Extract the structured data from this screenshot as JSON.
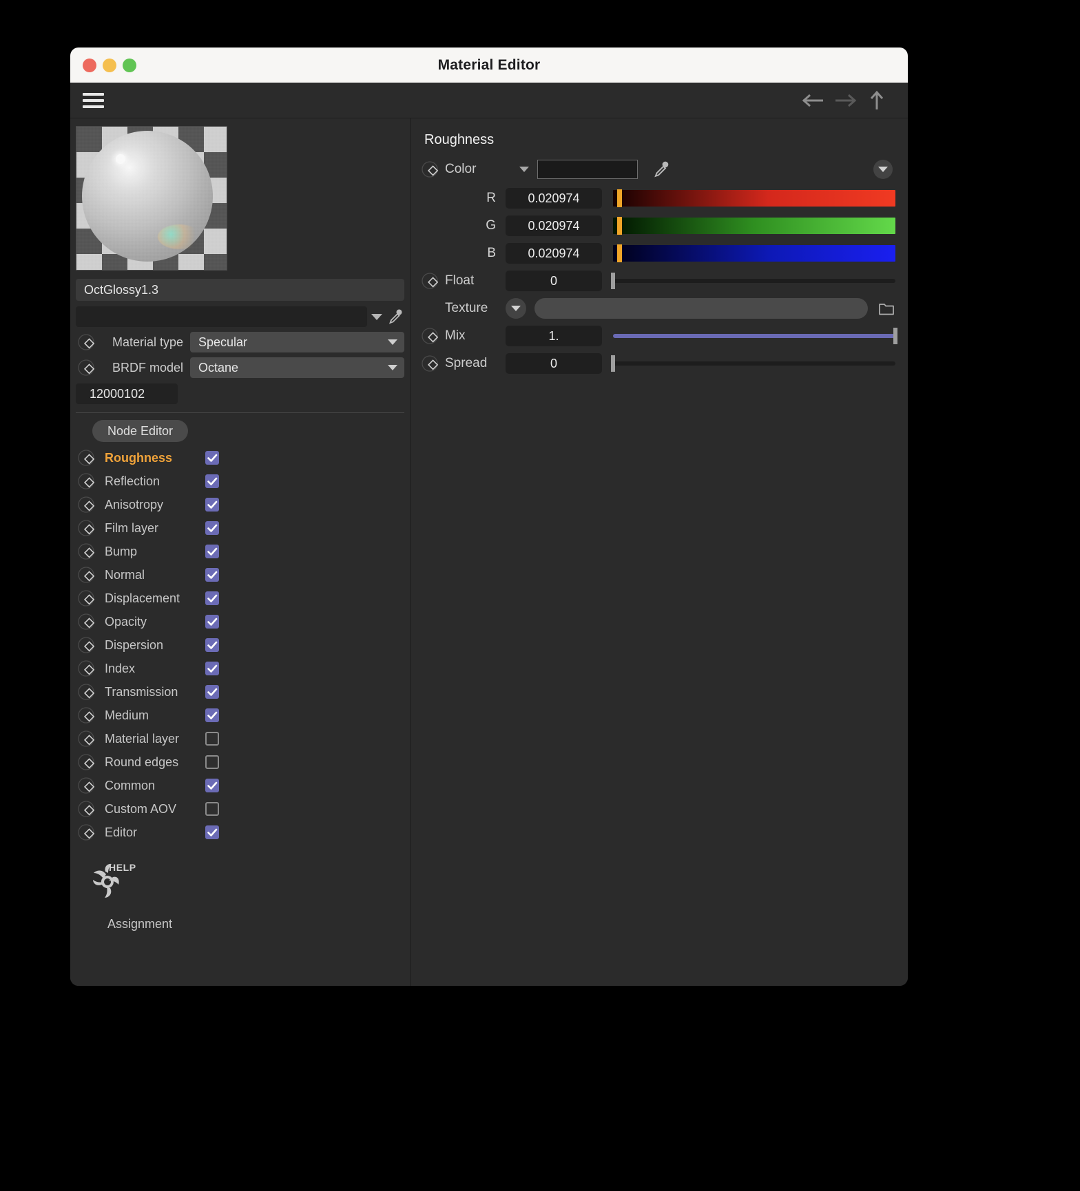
{
  "window": {
    "title": "Material Editor",
    "traffic_lights": [
      "close-button",
      "minimize-button",
      "maximize-button"
    ]
  },
  "toolbar": {
    "menu_icon": "hamburger-menu-icon",
    "back_icon": "arrow-left-icon",
    "forward_icon": "arrow-right-icon",
    "up_icon": "arrow-up-icon"
  },
  "left_panel": {
    "preview_alt": "material-preview-sphere",
    "material_name": "OctGlossy1.3",
    "combo_value": "",
    "eyedropper_icon": "eyedropper-icon",
    "params": [
      {
        "label": "Material type",
        "value": "Specular"
      },
      {
        "label": "BRDF model",
        "value": "Octane"
      }
    ],
    "material_id": "12000102",
    "tab_label": "Node Editor",
    "nodes": [
      {
        "label": "Roughness",
        "checked": true,
        "active": true
      },
      {
        "label": "Reflection",
        "checked": true,
        "active": false
      },
      {
        "label": "Anisotropy",
        "checked": true,
        "active": false
      },
      {
        "label": "Film layer",
        "checked": true,
        "active": false
      },
      {
        "label": "Bump",
        "checked": true,
        "active": false
      },
      {
        "label": "Normal",
        "checked": true,
        "active": false
      },
      {
        "label": "Displacement",
        "checked": true,
        "active": false
      },
      {
        "label": "Opacity",
        "checked": true,
        "active": false
      },
      {
        "label": "Dispersion",
        "checked": true,
        "active": false
      },
      {
        "label": "Index",
        "checked": true,
        "active": false
      },
      {
        "label": "Transmission",
        "checked": true,
        "active": false
      },
      {
        "label": "Medium",
        "checked": true,
        "active": false
      },
      {
        "label": "Material layer",
        "checked": false,
        "active": false
      },
      {
        "label": "Round edges",
        "checked": false,
        "active": false
      },
      {
        "label": "Common",
        "checked": true,
        "active": false
      },
      {
        "label": "Custom AOV",
        "checked": false,
        "active": false
      },
      {
        "label": "Editor",
        "checked": true,
        "active": false
      }
    ],
    "help_label": "HELP",
    "logo_icon": "octane-logo-icon",
    "assignment_label": "Assignment"
  },
  "right_panel": {
    "section_title": "Roughness",
    "color_row": {
      "label": "Color",
      "swatch_color": "#1a1a1a",
      "pipette_icon": "eyedropper-icon",
      "dropdown_icon": "chevron-down-icon"
    },
    "channels": [
      {
        "letter": "R",
        "value": "0.020974",
        "fraction": 0.021,
        "gradient_from": "#140000",
        "gradient_to": "#f03a22",
        "handle_color": "#f0a528"
      },
      {
        "letter": "G",
        "value": "0.020974",
        "fraction": 0.021,
        "gradient_from": "#001400",
        "gradient_to": "#63d94a",
        "handle_color": "#f0a528"
      },
      {
        "letter": "B",
        "value": "0.020974",
        "fraction": 0.021,
        "gradient_from": "#000018",
        "gradient_to": "#1a1ff0",
        "handle_color": "#f0a528"
      }
    ],
    "float_row": {
      "label": "Float",
      "value": "0",
      "fraction": 0.0
    },
    "texture_row": {
      "label": "Texture",
      "value": "",
      "dropdown_icon": "chevron-down-icon",
      "folder_icon": "folder-icon"
    },
    "mix_row": {
      "label": "Mix",
      "value": "1.",
      "fraction": 1.0,
      "fill_color": "#6a6ab4"
    },
    "spread_row": {
      "label": "Spread",
      "value": "0",
      "fraction": 0.0
    }
  }
}
